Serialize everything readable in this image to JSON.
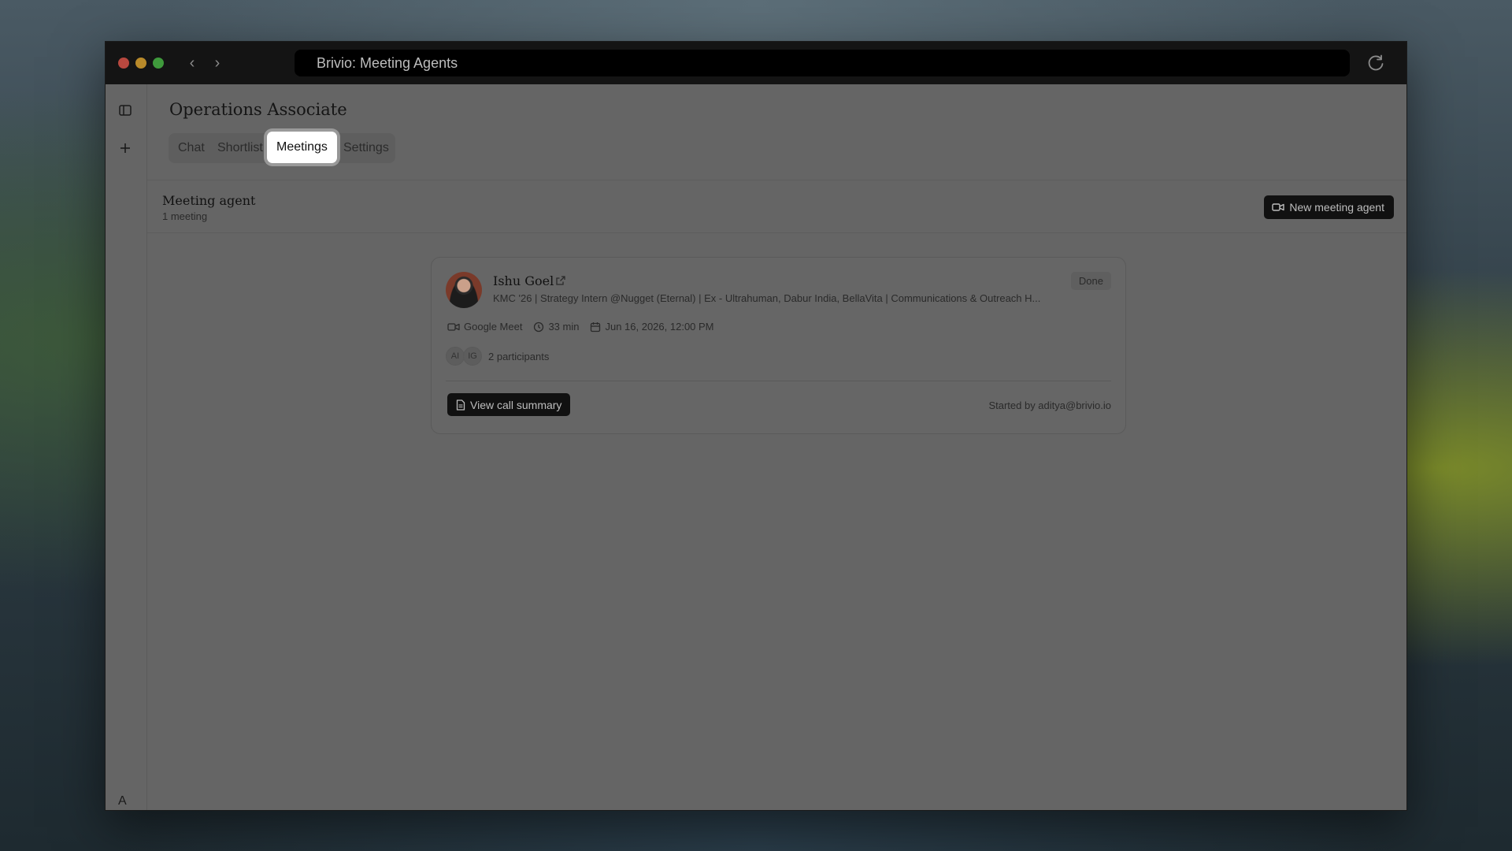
{
  "browser": {
    "url_title": "Brivio: Meeting Agents"
  },
  "sidebar": {
    "toggle_icon": "sidebar-icon",
    "add_icon": "plus-icon",
    "user_initial": "A"
  },
  "page": {
    "title": "Operations Associate",
    "tabs": [
      {
        "label": "Chat"
      },
      {
        "label": "Shortlist"
      },
      {
        "label": "Meetings",
        "active": true
      },
      {
        "label": "Settings"
      }
    ]
  },
  "section": {
    "title": "Meeting agent",
    "subtitle": "1 meeting",
    "new_button": "New meeting agent"
  },
  "meeting": {
    "name": "Ishu Goel",
    "headline": "KMC '26 | Strategy Intern @Nugget (Eternal) | Ex - Ultrahuman, Dabur India, BellaVita | Communications & Outreach H...",
    "status": "Done",
    "platform": "Google Meet",
    "duration": "33 min",
    "datetime": "Jun 16, 2026, 12:00 PM",
    "participant_initials": [
      "AI",
      "IG"
    ],
    "participants_label": "2 participants",
    "summary_button": "View call summary",
    "started_by": "Started by aditya@brivio.io"
  }
}
